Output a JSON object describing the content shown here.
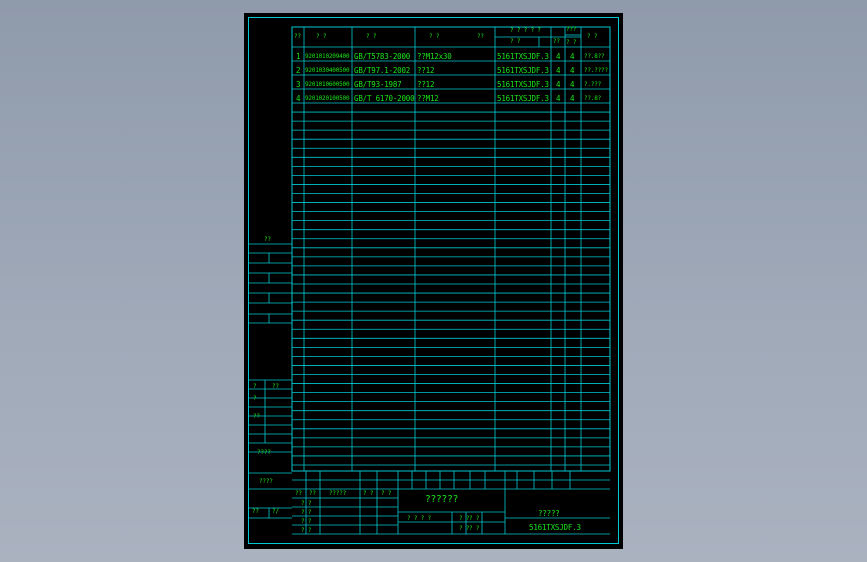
{
  "colors": {
    "lines": "#00c8d2",
    "text": "#19e619",
    "background": "#000000"
  },
  "bom": {
    "headers": {
      "seq": "??",
      "code": "? ?",
      "name": "? ?",
      "spec": "? ?",
      "qty": "??",
      "belong_top": "? ? ? ? ?",
      "belong_sub": "? ?",
      "belong_qty": "??",
      "col8_top": "???",
      "col8_bottom": "? ?",
      "remark": "? ?"
    },
    "rows": [
      {
        "seq": "1",
        "code": "9201010209400",
        "name": "GB/T5783-2000",
        "spec": "??M12x30",
        "belong": "5161TXSJDF.3",
        "c6": "4",
        "c7": "4",
        "remark": "??.8??"
      },
      {
        "seq": "2",
        "code": "9201030400500",
        "name": "GB/T97.1-2002",
        "spec": "??12",
        "belong": "5161TXSJDF.3",
        "c6": "4",
        "c7": "4",
        "remark": "??.????"
      },
      {
        "seq": "3",
        "code": "9201010600500",
        "name": "GB/T93-1987",
        "spec": "??12",
        "belong": "5161TXSJDF.3",
        "c6": "4",
        "c7": "4",
        "remark": "?.???"
      },
      {
        "seq": "4",
        "code": "9201020100500",
        "name": "GB/T 6170-2000",
        "spec": "??M12",
        "belong": "5161TXSJDF.3",
        "c6": "4",
        "c7": "4",
        "remark": "??.8?"
      }
    ]
  },
  "left_panel": {
    "top_label": "??",
    "mid_labels": [
      "?",
      "??",
      "?",
      "??"
    ],
    "bottom_label_1": "????",
    "bottom_label_2": "????",
    "sign_labels": [
      "??",
      "?/"
    ]
  },
  "title_block": {
    "headers": [
      "??",
      "??",
      "?????",
      "? ?",
      "? ?"
    ],
    "rows_labels": [
      "? ?",
      "? ?",
      "? ?",
      "? ?"
    ],
    "doc_title": "??????",
    "stage_label": "? ? ? ?",
    "sheet_labels": [
      "? ?",
      "? ?"
    ],
    "sheet_nums": [
      "? ?",
      "? ?"
    ],
    "product_name": "?????",
    "drawing_number": "5161TXSJDF.3"
  }
}
